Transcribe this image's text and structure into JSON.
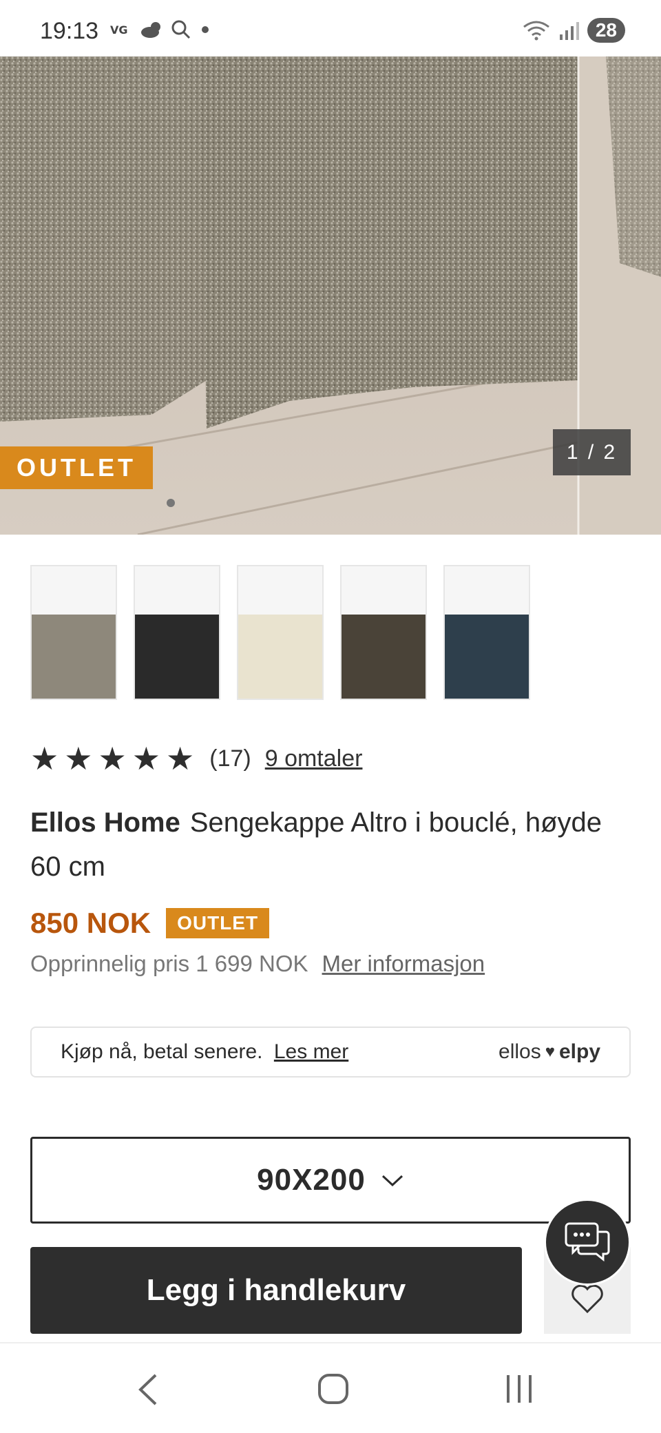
{
  "status_bar": {
    "time": "19:13",
    "battery": "28",
    "icons_left": [
      "vg-icon",
      "weather-icon",
      "search-icon",
      "dot-icon"
    ],
    "icons_right": [
      "wifi-icon",
      "signal-icon",
      "battery-icon"
    ]
  },
  "hero": {
    "badge": "OUTLET",
    "counter": "1 / 2"
  },
  "thumbnails": [
    {
      "color_name": "beige-grey",
      "color": "#8e887b"
    },
    {
      "color_name": "black",
      "color": "#2a2a2a"
    },
    {
      "color_name": "cream",
      "color": "#e9e3cf"
    },
    {
      "color_name": "dark-brown",
      "color": "#4a4338"
    },
    {
      "color_name": "dark-blue",
      "color": "#2e3f4c"
    }
  ],
  "rating": {
    "stars": 5,
    "count": "(17)",
    "reviews_link": "9 omtaler"
  },
  "product": {
    "brand": "Ellos Home",
    "name": "Sengekappe Altro i bouclé, høyde 60 cm"
  },
  "price": {
    "current": "850 NOK",
    "badge": "OUTLET",
    "original": "Opprinnelig pris 1 699 NOK",
    "more_info": "Mer informasjon"
  },
  "payment": {
    "text": "Kjøp nå, betal senere.",
    "link": "Les mer",
    "logo_left": "ellos",
    "logo_right": "elpy"
  },
  "size_select": {
    "value": "90X200"
  },
  "actions": {
    "add_to_cart": "Legg i handlekurv"
  },
  "colors": {
    "accent_orange": "#d9891c",
    "price_orange": "#b8560c",
    "dark_button": "#2e2e2e"
  }
}
